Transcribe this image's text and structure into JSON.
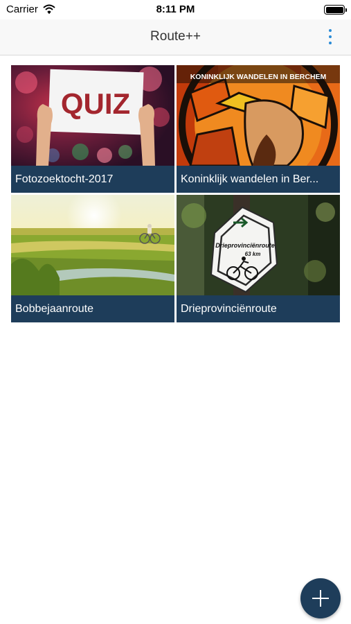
{
  "status_bar": {
    "carrier": "Carrier",
    "time": "8:11 PM"
  },
  "nav": {
    "title": "Route++"
  },
  "routes": [
    {
      "title": "Fotozoektocht-2017",
      "image_text": "QUIZ"
    },
    {
      "title": "Koninklijk wandelen in Berchem",
      "display": "Koninklijk wandelen in Ber...",
      "image_text": "KONINKLIJK WANDELEN IN BERCHEM"
    },
    {
      "title": "Bobbejaanroute"
    },
    {
      "title": "Drieprovinciënroute",
      "sign_text": "Drieprovinciënroute",
      "sign_distance": "63 km"
    }
  ],
  "colors": {
    "accent": "#2a8bd6",
    "caption_bg": "#1e3d5a",
    "fab_bg": "#1e3d5a"
  },
  "fab": {
    "icon": "plus-icon"
  }
}
